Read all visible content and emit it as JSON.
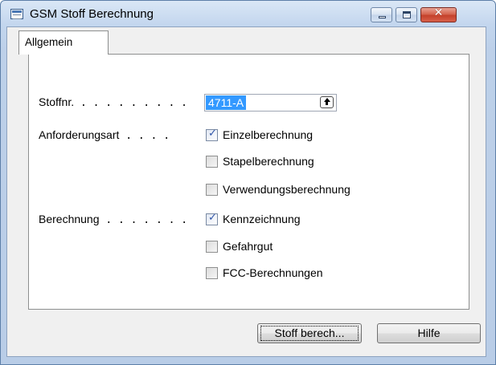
{
  "window": {
    "title": "GSM Stoff Berechnung",
    "icon": "form-icon",
    "controls": {
      "minimize": "minimize-icon",
      "maximize": "maximize-icon",
      "close": "close-icon"
    }
  },
  "tabs": [
    {
      "label": "Allgemein",
      "active": true
    }
  ],
  "form": {
    "stoffnr": {
      "label": "Stoffnr.",
      "dots": ". . . . . . . . .",
      "value": "4711-A",
      "lookup_icon": "lookup-arrow-icon"
    },
    "anforderungsart": {
      "label": "Anforderungsart",
      "dots": ". . . .",
      "options": [
        {
          "label": "Einzelberechnung",
          "checked": true
        },
        {
          "label": "Stapelberechnung",
          "checked": false
        },
        {
          "label": "Verwendungsberechnung",
          "checked": false
        }
      ]
    },
    "berechnung": {
      "label": "Berechnung",
      "dots": ". . . . . . .",
      "options": [
        {
          "label": "Kennzeichnung",
          "checked": true
        },
        {
          "label": "Gefahrgut",
          "checked": false
        },
        {
          "label": "FCC-Berechnungen",
          "checked": false
        }
      ]
    }
  },
  "buttons": {
    "stoff_berech": "Stoff berech...",
    "hilfe": "Hilfe"
  }
}
